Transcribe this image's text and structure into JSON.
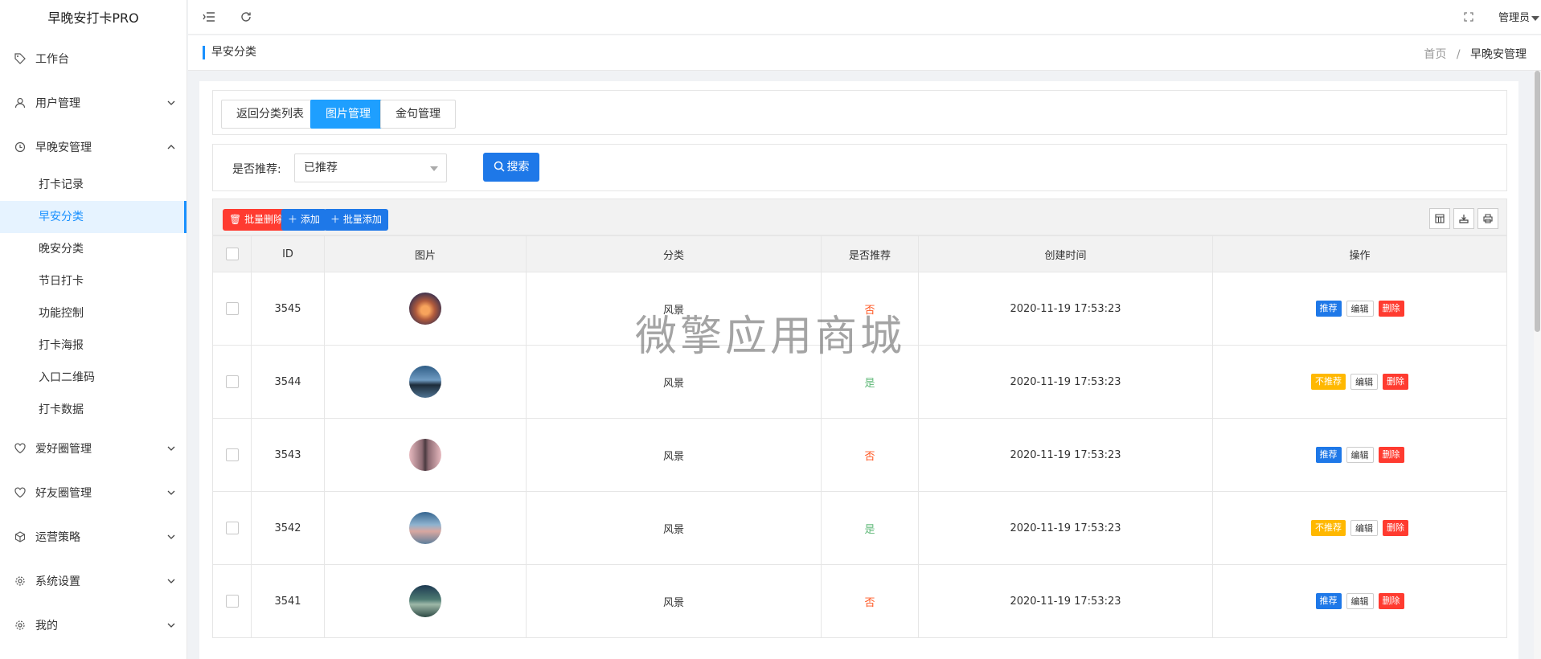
{
  "app": {
    "title": "早晚安打卡PRO"
  },
  "sidebar": {
    "items": [
      {
        "label": "工作台",
        "icon": "tag-icon"
      },
      {
        "label": "用户管理",
        "icon": "user-icon"
      },
      {
        "label": "早晚安管理",
        "icon": "clock-icon"
      },
      {
        "label": "爱好圈管理",
        "icon": "heart-icon"
      },
      {
        "label": "好友圈管理",
        "icon": "heart-icon"
      },
      {
        "label": "运营策略",
        "icon": "cube-icon"
      },
      {
        "label": "系统设置",
        "icon": "gear-icon"
      },
      {
        "label": "我的",
        "icon": "gear-icon"
      }
    ],
    "subitems": [
      "打卡记录",
      "早安分类",
      "晚安分类",
      "节日打卡",
      "功能控制",
      "打卡海报",
      "入口二维码",
      "打卡数据"
    ],
    "active_sub": "早安分类"
  },
  "header": {
    "user": "管理员"
  },
  "page": {
    "title": "早安分类",
    "breadcrumb_home": "首页",
    "breadcrumb_current": "早晚安管理",
    "breadcrumb_sep": "/"
  },
  "tabs": [
    "返回分类列表",
    "图片管理",
    "金句管理"
  ],
  "filter": {
    "label": "是否推荐:",
    "selected": "已推荐",
    "search": "搜索"
  },
  "toolbar": {
    "batch_delete": "批量删除",
    "add": "添加",
    "batch_add": "批量添加"
  },
  "table": {
    "columns": [
      "ID",
      "图片",
      "分类",
      "是否推荐",
      "创建时间",
      "操作"
    ],
    "rows": [
      {
        "id": "3545",
        "category": "风景",
        "recommended": "否",
        "time": "2020-11-19 17:53:23",
        "action": "推荐",
        "edit": "编辑",
        "delete": "删除"
      },
      {
        "id": "3544",
        "category": "风景",
        "recommended": "是",
        "time": "2020-11-19 17:53:23",
        "action": "不推荐",
        "edit": "编辑",
        "delete": "删除"
      },
      {
        "id": "3543",
        "category": "风景",
        "recommended": "否",
        "time": "2020-11-19 17:53:23",
        "action": "推荐",
        "edit": "编辑",
        "delete": "删除"
      },
      {
        "id": "3542",
        "category": "风景",
        "recommended": "是",
        "time": "2020-11-19 17:53:23",
        "action": "不推荐",
        "edit": "编辑",
        "delete": "删除"
      },
      {
        "id": "3541",
        "category": "风景",
        "recommended": "否",
        "time": "2020-11-19 17:53:23",
        "action": "推荐",
        "edit": "编辑",
        "delete": "删除"
      }
    ]
  },
  "watermark": "微擎应用商城",
  "colors": {
    "accent": "#1e9fff",
    "danger": "#ff3b30",
    "warning": "#ffb800",
    "no": "#ff5722",
    "yes": "#5fb878"
  }
}
